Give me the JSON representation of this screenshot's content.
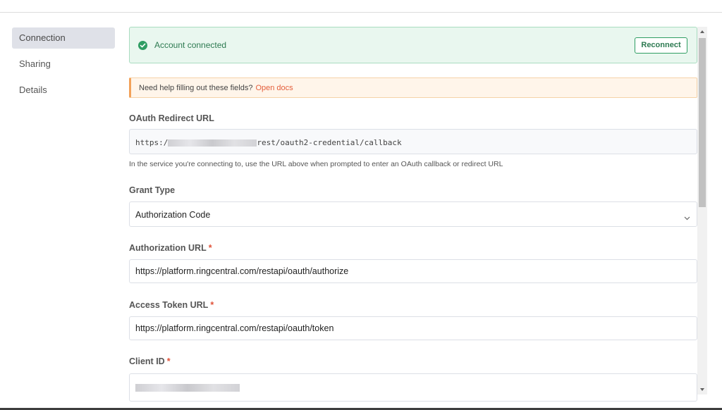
{
  "sidebar": {
    "items": [
      {
        "label": "Connection",
        "active": true
      },
      {
        "label": "Sharing",
        "active": false
      },
      {
        "label": "Details",
        "active": false
      }
    ]
  },
  "status": {
    "text": "Account connected",
    "icon": "check-circle-icon",
    "color": "#2f9d63",
    "reconnect_label": "Reconnect"
  },
  "help": {
    "text": "Need help filling out these fields?",
    "link": "Open docs"
  },
  "form": {
    "redirect": {
      "label": "OAuth Redirect URL",
      "value_prefix": "https:/",
      "value_suffix": "rest/oauth2-credential/callback",
      "hint": "In the service you're connecting to, use the URL above when prompted to enter an OAuth callback or redirect URL"
    },
    "grant_type": {
      "label": "Grant Type",
      "value": "Authorization Code"
    },
    "auth_url": {
      "label": "Authorization URL",
      "required": "*",
      "value": "https://platform.ringcentral.com/restapi/oauth/authorize"
    },
    "token_url": {
      "label": "Access Token URL",
      "required": "*",
      "value": "https://platform.ringcentral.com/restapi/oauth/token"
    },
    "client_id": {
      "label": "Client ID",
      "required": "*"
    }
  }
}
